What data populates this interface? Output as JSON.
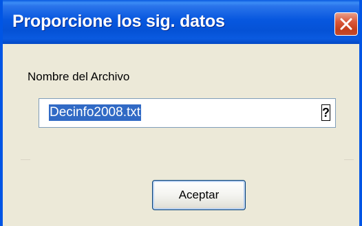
{
  "window": {
    "title": "Proporcione los sig. datos",
    "close_icon": "close-icon"
  },
  "form": {
    "prompt_label": "Nombre del Archivo",
    "filename_value": "Decinfo2008.txt",
    "help_glyph": "?",
    "help_icon": "question-mark-icon"
  },
  "buttons": {
    "accept_label": "Aceptar"
  },
  "colors": {
    "titlebar": "#0055e5",
    "close_button": "#d9573a",
    "selection": "#316ac5",
    "face": "#ece9d8"
  }
}
